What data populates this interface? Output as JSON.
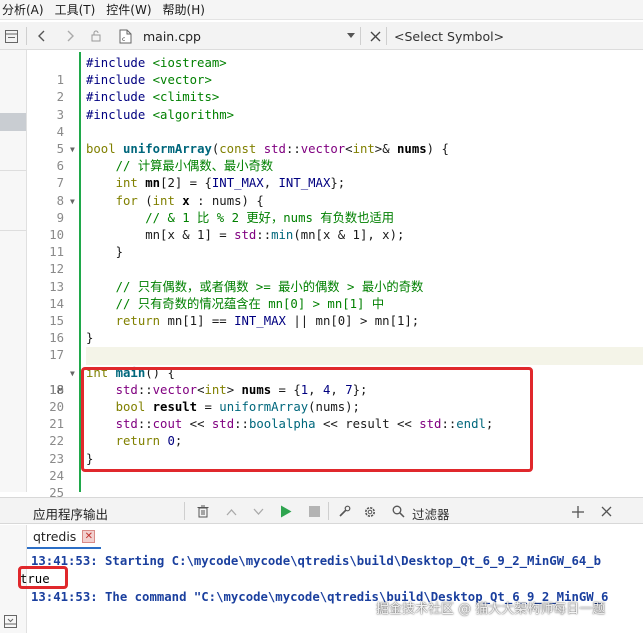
{
  "menubar": {
    "items": [
      "分析(A)",
      "工具(T)",
      "控件(W)",
      "帮助(H)"
    ]
  },
  "toolbar": {
    "file_name": "main.cpp",
    "symbol_placeholder": "<Select Symbol>",
    "icons": [
      "back-icon",
      "forward-icon",
      "lock-icon",
      "file-icon",
      "dropdown-icon",
      "close-icon"
    ]
  },
  "editor": {
    "lines": [
      {
        "n": "1"
      },
      {
        "n": "2"
      },
      {
        "n": "3"
      },
      {
        "n": "4"
      },
      {
        "n": "5"
      },
      {
        "n": "6"
      },
      {
        "n": "7"
      },
      {
        "n": "8"
      },
      {
        "n": "9"
      },
      {
        "n": "10"
      },
      {
        "n": "11"
      },
      {
        "n": "12"
      },
      {
        "n": "13"
      },
      {
        "n": "14"
      },
      {
        "n": "15"
      },
      {
        "n": "16"
      },
      {
        "n": "17"
      },
      {
        "n": "18"
      },
      {
        "n": "19"
      },
      {
        "n": "20"
      },
      {
        "n": "21"
      },
      {
        "n": "22"
      },
      {
        "n": "23"
      },
      {
        "n": "24"
      },
      {
        "n": "25"
      }
    ],
    "current_line": "18",
    "code": {
      "l1": [
        "#include",
        "<iostream>"
      ],
      "l2": [
        "#include",
        "<vector>"
      ],
      "l3": [
        "#include",
        "<climits>"
      ],
      "l4": [
        "#include",
        "<algorithm>"
      ],
      "l6": [
        "bool",
        "uniformArray",
        "(",
        "const",
        "std",
        "::",
        "vector",
        "<",
        "int",
        ">& ",
        "nums",
        ") {"
      ],
      "l7": "// 计算最小偶数、最小奇数",
      "l8": [
        "int",
        "mn",
        "[2] = {",
        "INT_MAX",
        ", ",
        "INT_MAX",
        "};"
      ],
      "l9": [
        "for",
        " (",
        "int",
        "x",
        " : nums) {"
      ],
      "l10": "// & 1 比 % 2 更好，nums 有负数也适用",
      "l11": [
        "mn[x & 1] = ",
        "std",
        "::",
        "min",
        "(mn[x & 1], x);"
      ],
      "l12": "}",
      "l14": "// 只有偶数，或者偶数 >= 最小的偶数 > 最小的奇数",
      "l15": "// 只有奇数的情况蕴含在 mn[0] > mn[1] 中",
      "l16": [
        "return",
        " mn[1] == ",
        "INT_MAX",
        " || mn[0] > mn[1];"
      ],
      "l17": "}",
      "l19": [
        "int",
        "main",
        "() {"
      ],
      "l20": [
        "std",
        "::",
        "vector",
        "<",
        "int",
        "> ",
        "nums",
        " = {",
        "1",
        ", ",
        "4",
        ", ",
        "7",
        "};"
      ],
      "l21": [
        "bool",
        "result",
        " = ",
        "uniformArray",
        "(nums);"
      ],
      "l22": [
        "std",
        "::",
        "cout",
        " << ",
        "std",
        "::",
        "boolalpha",
        " << result << ",
        "std",
        "::",
        "endl",
        ";"
      ],
      "l23": [
        "return",
        " ",
        "0",
        ";"
      ],
      "l24": "}"
    }
  },
  "output": {
    "title": "应用程序输出",
    "filter_label": "过滤器",
    "tab_label": "qtredis",
    "lines": [
      "13:41:53: Starting C:\\mycode\\mycode\\qtredis\\build\\Desktop_Qt_6_9_2_MinGW_64_b",
      "true",
      "13:41:53: The command \"C:\\mycode\\mycode\\qtredis\\build\\Desktop_Qt_6_9_2_MinGW_6"
    ]
  },
  "watermark": "掘金技术社区 @ 猫大大架构师每日一题",
  "colors": {
    "highlight_box": "#e0282c",
    "change_bar": "#1fa84a",
    "output_blue": "#1a3f9e"
  }
}
